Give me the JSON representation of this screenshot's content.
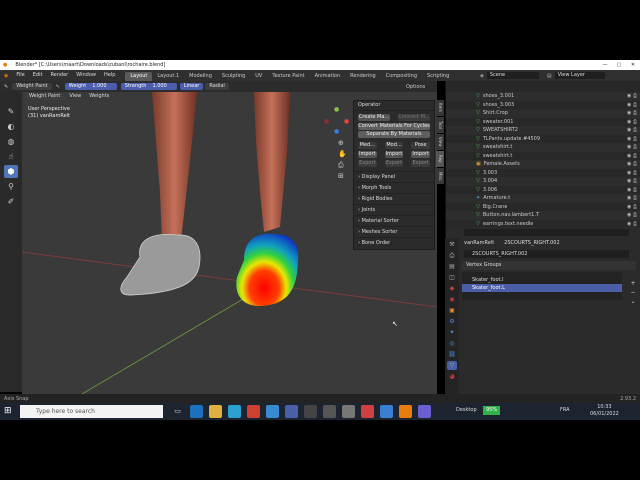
{
  "titlebar": {
    "title": "Blender* [C:\\Users\\maart\\Downloads\\zubanl\\rochaire.blend]",
    "min": "—",
    "max": "▢",
    "close": "✕"
  },
  "menu": [
    "File",
    "Edit",
    "Render",
    "Window",
    "Help"
  ],
  "workspaces": [
    "Layout",
    "Layout.1",
    "Modeling",
    "Sculpting",
    "UV",
    "Texture Paint",
    "Animation",
    "Rendering",
    "Compositing",
    "Scripting"
  ],
  "scene": {
    "label": "Scene",
    "viewlayer": "View Layer"
  },
  "toolheader": {
    "mode": "Weight Paint",
    "weight_label": "Weight",
    "weight_value": "1.000",
    "strength_label": "Strength",
    "strength_value": "1.000",
    "blend": "Linear",
    "falloff": "Radial",
    "view": "View",
    "weights": "Weights",
    "options": "Options"
  },
  "viewport": {
    "perspective": "User Perspective",
    "object": "(31) vanRamRelt"
  },
  "npanel": {
    "operator": "Operator",
    "create_btn": "Create Ma...",
    "connect_btn": "Connect M...",
    "convert_btn": "Convert Materials For Cycles",
    "separate_btn": "Separate By Materials",
    "row2": [
      "Med...",
      "Mod...",
      "Pose"
    ],
    "import_row": [
      "Import",
      "Import",
      "Import"
    ],
    "export_row": [
      "Export",
      "Export",
      "Export"
    ],
    "sections": [
      "Display Panel",
      "Morph Tools",
      "Rigid Bodies",
      "Joints",
      "Material Sorter",
      "Meshes Sorter",
      "Bone Order"
    ]
  },
  "vtabs": [
    "Item",
    "Tool",
    "View",
    "Rep",
    "Misc"
  ],
  "outliner": {
    "items": [
      "shoes_3.001",
      "shoes_3.003",
      "Shirt.Crop",
      "sweater.001",
      "SWEATSHIRT2",
      "TLPants.update.#4509",
      "sweatshirt.t",
      "sweatshirt.t",
      "Female.Assets",
      "3.003",
      "3.004",
      "3.006",
      "Armature.t",
      "Big.Crane",
      "Button.nav.lambert1.T",
      "earrings.text.needle"
    ]
  },
  "props": {
    "object": "vanRamRelt",
    "mesh": "2SCOURTS_RIGHT.002",
    "mesh_field": "2SCOURTS_RIGHT.002",
    "vertex_groups_label": "Vertex Groups",
    "groups": [
      "Skater_foot.l",
      "Skater_foot.L"
    ]
  },
  "statusbar": {
    "left": "Axis Snap",
    "right": "2.93.2"
  },
  "taskbar": {
    "search": "Type here to search",
    "desktop": "Desktop",
    "battery": "95%",
    "lang": "FRA",
    "time": "10:33",
    "date": "06/01/2022"
  },
  "colors": {
    "accent": "#4b5dad",
    "active_tool": "#5274b8",
    "viewport_bg": "#3a3a3a",
    "selected_group": "#4a5fa8"
  }
}
